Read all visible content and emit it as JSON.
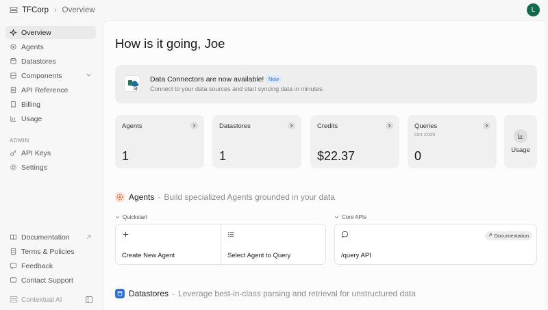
{
  "topbar": {
    "org_name": "TFCorp",
    "breadcrumb": "Overview",
    "avatar_initial": "L",
    "avatar_color": "#0f6b4a"
  },
  "sidebar": {
    "items": [
      {
        "label": "Overview",
        "icon": "sparkle-icon",
        "active": true
      },
      {
        "label": "Agents",
        "icon": "agent-icon"
      },
      {
        "label": "Datastores",
        "icon": "database-icon"
      },
      {
        "label": "Components",
        "icon": "components-icon"
      },
      {
        "label": "API Reference",
        "icon": "document-icon"
      },
      {
        "label": "Billing",
        "icon": "receipt-icon"
      },
      {
        "label": "Usage",
        "icon": "chart-icon"
      }
    ],
    "admin_label": "ADMIN",
    "admin_items": [
      {
        "label": "API Keys",
        "icon": "key-icon"
      },
      {
        "label": "Settings",
        "icon": "gear-icon"
      }
    ],
    "footer_items": [
      {
        "label": "Documentation",
        "icon": "book-icon"
      },
      {
        "label": "Terms & Policies",
        "icon": "document-icon"
      },
      {
        "label": "Feedback",
        "icon": "message-icon"
      },
      {
        "label": "Contact Support",
        "icon": "chat-icon"
      }
    ],
    "brand": "Contextual AI"
  },
  "main": {
    "greeting": "How is it going, Joe",
    "banner": {
      "title": "Data Connectors are now available!",
      "badge": "New",
      "subtitle": "Connect to your data sources and start syncing data in minutes."
    },
    "stats": [
      {
        "label": "Agents",
        "value": "1",
        "sub": ""
      },
      {
        "label": "Datastores",
        "value": "1",
        "sub": ""
      },
      {
        "label": "Credits",
        "value": "$22.37",
        "sub": ""
      },
      {
        "label": "Queries",
        "value": "0",
        "sub": "Oct 2025"
      }
    ],
    "usage_label": "Usage",
    "agents_section": {
      "title": "Agents",
      "description": "Build specialized Agents grounded in your data",
      "accent": "#e8602c"
    },
    "quickstart": {
      "label": "Quickstart",
      "items": [
        {
          "label": "Create New Agent",
          "icon": "plus-icon"
        },
        {
          "label": "Select Agent to Query",
          "icon": "list-icon"
        }
      ]
    },
    "core_apis": {
      "label": "Core APIs",
      "badge": "Documentation",
      "item_label": "/query API"
    },
    "datastores_section": {
      "title": "Datastores",
      "description": "Leverage best-in-class parsing and retrieval for unstructured data",
      "accent": "#2d6ed6"
    }
  }
}
